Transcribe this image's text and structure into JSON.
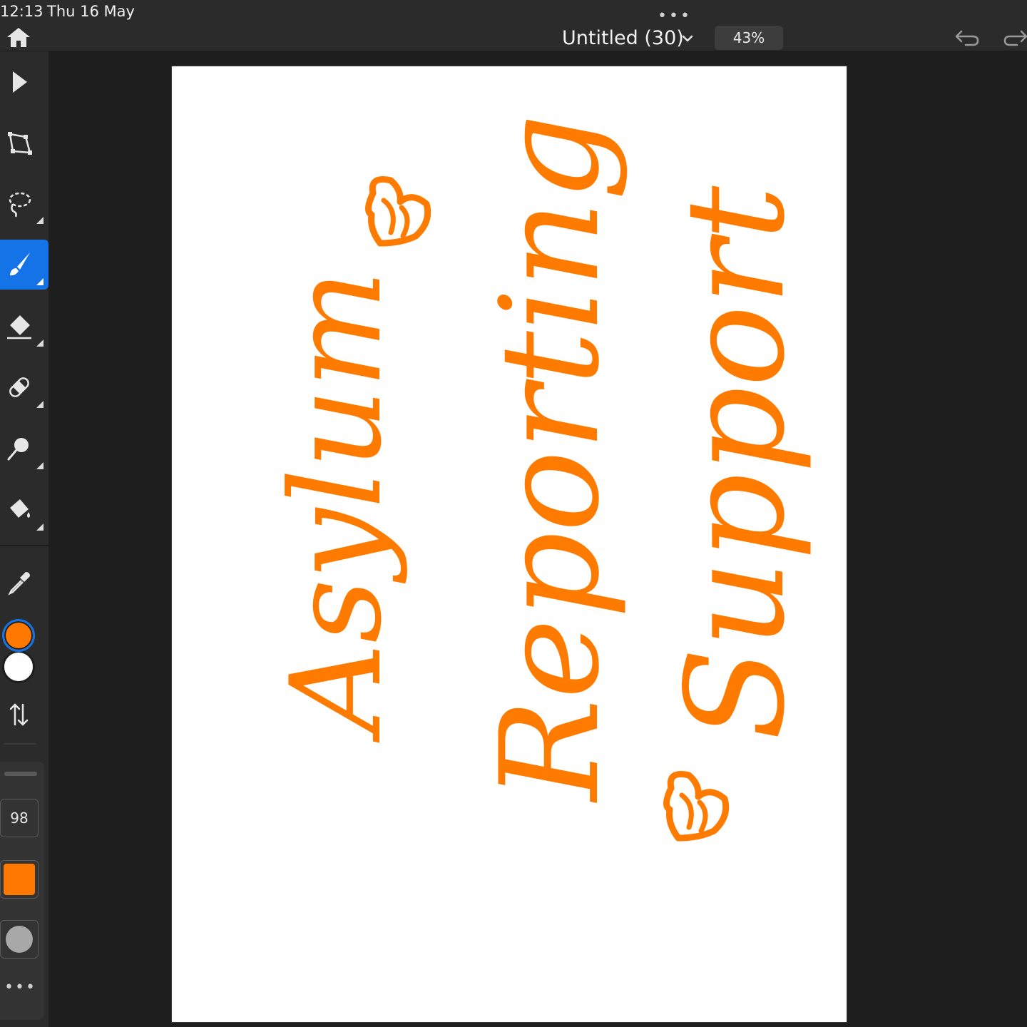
{
  "status": {
    "time": "12:13",
    "date": "Thu 16 May"
  },
  "header": {
    "title": "Untitled (30)",
    "zoom": "43%",
    "menu_dots": "•••"
  },
  "toolbar": {
    "tools": [
      {
        "name": "Select",
        "icon": "arrow-cursor-icon"
      },
      {
        "name": "Transform",
        "icon": "transform-icon"
      },
      {
        "name": "Lasso",
        "icon": "lasso-icon"
      },
      {
        "name": "Brush",
        "icon": "brush-icon",
        "active": true
      },
      {
        "name": "Eraser",
        "icon": "eraser-icon"
      },
      {
        "name": "Healing",
        "icon": "bandage-icon"
      },
      {
        "name": "Smudge",
        "icon": "smudge-icon"
      },
      {
        "name": "Fill",
        "icon": "paint-bucket-icon"
      },
      {
        "name": "Eyedropper",
        "icon": "eyedropper-icon"
      }
    ],
    "foreground_color": "#ff7800",
    "background_color": "#ffffff"
  },
  "props": {
    "size": "98",
    "color": "#ff7800",
    "more": "•••"
  },
  "canvas": {
    "lines": [
      "Asylum",
      "Reporting",
      "Support"
    ],
    "ink_color": "#ff7b00"
  }
}
